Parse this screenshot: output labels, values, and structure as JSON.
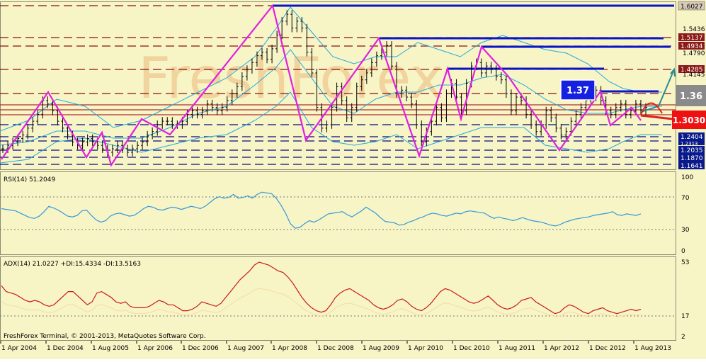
{
  "colors": {
    "background": "#f7f4c6",
    "candle": "#000000",
    "zigzag": "#e020e0",
    "bollinger": "#22aadd",
    "resistance": "#0a14c8",
    "level_dash": "#8b1010",
    "support_dash": "#0a0a80",
    "rsi_line": "#3399dd",
    "adx_line": "#cc1a1a",
    "di_line": "#f6dca0",
    "watermark": "#f0c890",
    "callout_blue": "#1520e0",
    "callout_grey": "#8a8a8a",
    "callout_red": "#ee1111",
    "arrow_teal": "#2a8f8f",
    "arrow_red": "#dd2222"
  },
  "watermark": "FreshForex",
  "footer": "FreshForex Terminal, © 2001-2013, MetaQuotes Software Corp.",
  "price_labels": {
    "top": "1.6027",
    "r1": "1.5436",
    "r2": "1.5137",
    "r3": "1.4934",
    "r4": "1.4790",
    "r5": "1.4285",
    "r6": "1.4145",
    "s1": "1.2404",
    "s2": "1.2313",
    "s3": "1.2035",
    "s4": "1.1870",
    "s5": "1.1641"
  },
  "callouts": {
    "blue": "1.37",
    "grey": "1.36",
    "red": "1.3030"
  },
  "rsi": {
    "label": "RSI(14) 51.2049",
    "ticks": [
      "100",
      "70",
      "30",
      "0"
    ]
  },
  "adx": {
    "label": "ADX(14) 21.0227 +DI:15.4334 -DI:13.5163",
    "ticks": [
      "53",
      "17",
      "2"
    ]
  },
  "chart_data": {
    "type": "candlestick",
    "title": "",
    "x": [
      "1 Apr 2004",
      "1 Dec 2004",
      "1 Aug 2005",
      "1 Apr 2006",
      "1 Dec 2006",
      "1 Aug 2007",
      "1 Apr 2008",
      "1 Dec 2008",
      "1 Aug 2009",
      "1 Apr 2010",
      "1 Dec 2010",
      "1 Aug 2011",
      "1 Apr 2012",
      "1 Dec 2012",
      "1 Aug 2013"
    ],
    "ylim": [
      1.155,
      1.615
    ],
    "close": [
      1.2,
      1.21,
      1.22,
      1.23,
      1.24,
      1.26,
      1.28,
      1.3,
      1.34,
      1.33,
      1.31,
      1.28,
      1.26,
      1.24,
      1.22,
      1.21,
      1.22,
      1.23,
      1.22,
      1.21,
      1.2,
      1.19,
      1.2,
      1.21,
      1.2,
      1.19,
      1.2,
      1.21,
      1.22,
      1.24,
      1.25,
      1.27,
      1.28,
      1.28,
      1.27,
      1.27,
      1.28,
      1.3,
      1.31,
      1.3,
      1.31,
      1.33,
      1.32,
      1.31,
      1.32,
      1.34,
      1.36,
      1.38,
      1.41,
      1.43,
      1.45,
      1.47,
      1.48,
      1.46,
      1.49,
      1.53,
      1.57,
      1.59,
      1.55,
      1.57,
      1.55,
      1.48,
      1.42,
      1.32,
      1.26,
      1.27,
      1.32,
      1.38,
      1.34,
      1.29,
      1.32,
      1.38,
      1.4,
      1.42,
      1.45,
      1.47,
      1.48,
      1.5,
      1.44,
      1.36,
      1.37,
      1.35,
      1.33,
      1.27,
      1.22,
      1.25,
      1.28,
      1.32,
      1.29,
      1.36,
      1.39,
      1.35,
      1.31,
      1.39,
      1.44,
      1.45,
      1.42,
      1.44,
      1.43,
      1.41,
      1.4,
      1.36,
      1.31,
      1.35,
      1.34,
      1.3,
      1.27,
      1.25,
      1.27,
      1.31,
      1.29,
      1.26,
      1.24,
      1.25,
      1.28,
      1.3,
      1.32,
      1.34,
      1.35,
      1.37,
      1.34,
      1.31,
      1.3,
      1.32,
      1.33,
      1.3,
      1.31,
      1.33,
      1.31,
      1.32
    ],
    "series": [
      {
        "name": "RSI(14)",
        "values": [
          58,
          57,
          56,
          55,
          52,
          49,
          46,
          45,
          48,
          54,
          61,
          59,
          56,
          52,
          48,
          47,
          49,
          55,
          56,
          49,
          43,
          40,
          42,
          48,
          51,
          52,
          50,
          48,
          49,
          53,
          58,
          61,
          60,
          57,
          56,
          58,
          60,
          59,
          57,
          59,
          61,
          60,
          58,
          61,
          66,
          71,
          74,
          72,
          73,
          77,
          72,
          73,
          75,
          72,
          77,
          80,
          79,
          78,
          72,
          63,
          52,
          38,
          32,
          33,
          38,
          42,
          40,
          43,
          47,
          51,
          52,
          53,
          54,
          50,
          47,
          51,
          55,
          60,
          56,
          52,
          46,
          41,
          40,
          39,
          36,
          37,
          40,
          42,
          45,
          47,
          50,
          52,
          51,
          49,
          48,
          50,
          52,
          51,
          54,
          55,
          54,
          53,
          52,
          48,
          45,
          47,
          45,
          44,
          42,
          44,
          46,
          44,
          42,
          41,
          40,
          38,
          36,
          35,
          37,
          40,
          42,
          44,
          45,
          46,
          47,
          49,
          50,
          51,
          52,
          54,
          50,
          49,
          51,
          50,
          49,
          51
        ]
      },
      {
        "name": "ADX(14)",
        "values": [
          37,
          33,
          32,
          31,
          29,
          27,
          26,
          27,
          26,
          24,
          23,
          24,
          27,
          30,
          33,
          33,
          30,
          27,
          24,
          26,
          32,
          33,
          31,
          29,
          26,
          25,
          26,
          23,
          22,
          22,
          22,
          23,
          25,
          27,
          26,
          24,
          24,
          22,
          20,
          20,
          21,
          23,
          26,
          25,
          24,
          23,
          25,
          29,
          33,
          37,
          41,
          44,
          47,
          51,
          53,
          52,
          51,
          49,
          47,
          46,
          43,
          39,
          34,
          29,
          25,
          22,
          20,
          19,
          20,
          24,
          29,
          32,
          34,
          35,
          33,
          31,
          29,
          27,
          24,
          22,
          21,
          22,
          24,
          27,
          28,
          26,
          23,
          21,
          20,
          22,
          25,
          29,
          33,
          35,
          34,
          32,
          30,
          28,
          26,
          25,
          26,
          28,
          30,
          27,
          24,
          22,
          21,
          22,
          24,
          27,
          28,
          29,
          26,
          24,
          22,
          20,
          18,
          19,
          22,
          24,
          23,
          21,
          19,
          18,
          20,
          21,
          22,
          20,
          19,
          18,
          19,
          20,
          21,
          20,
          21
        ]
      }
    ]
  }
}
